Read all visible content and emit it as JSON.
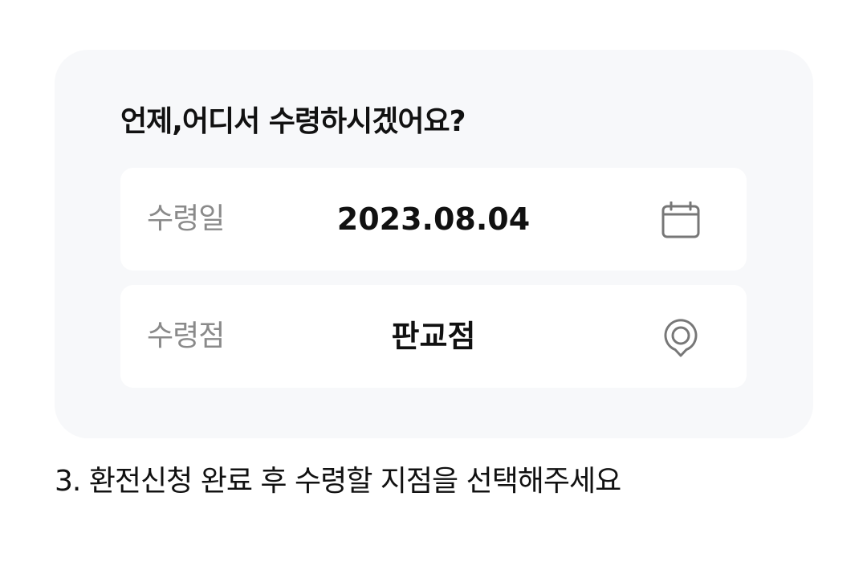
{
  "card": {
    "title": "언제,어디서 수령하시겠어요?",
    "rows": [
      {
        "label": "수령일",
        "value": "2023.08.04",
        "icon": "calendar-icon"
      },
      {
        "label": "수령점",
        "value": "판교점",
        "icon": "location-pin-icon"
      }
    ]
  },
  "caption": "3. 환전신청 완료 후 수령할 지점을 선택해주세요",
  "colors": {
    "card_background": "#f7f8fa",
    "row_background": "#ffffff",
    "label_text": "#8a8a8a",
    "value_text": "#111111",
    "icon_stroke": "#777777"
  }
}
